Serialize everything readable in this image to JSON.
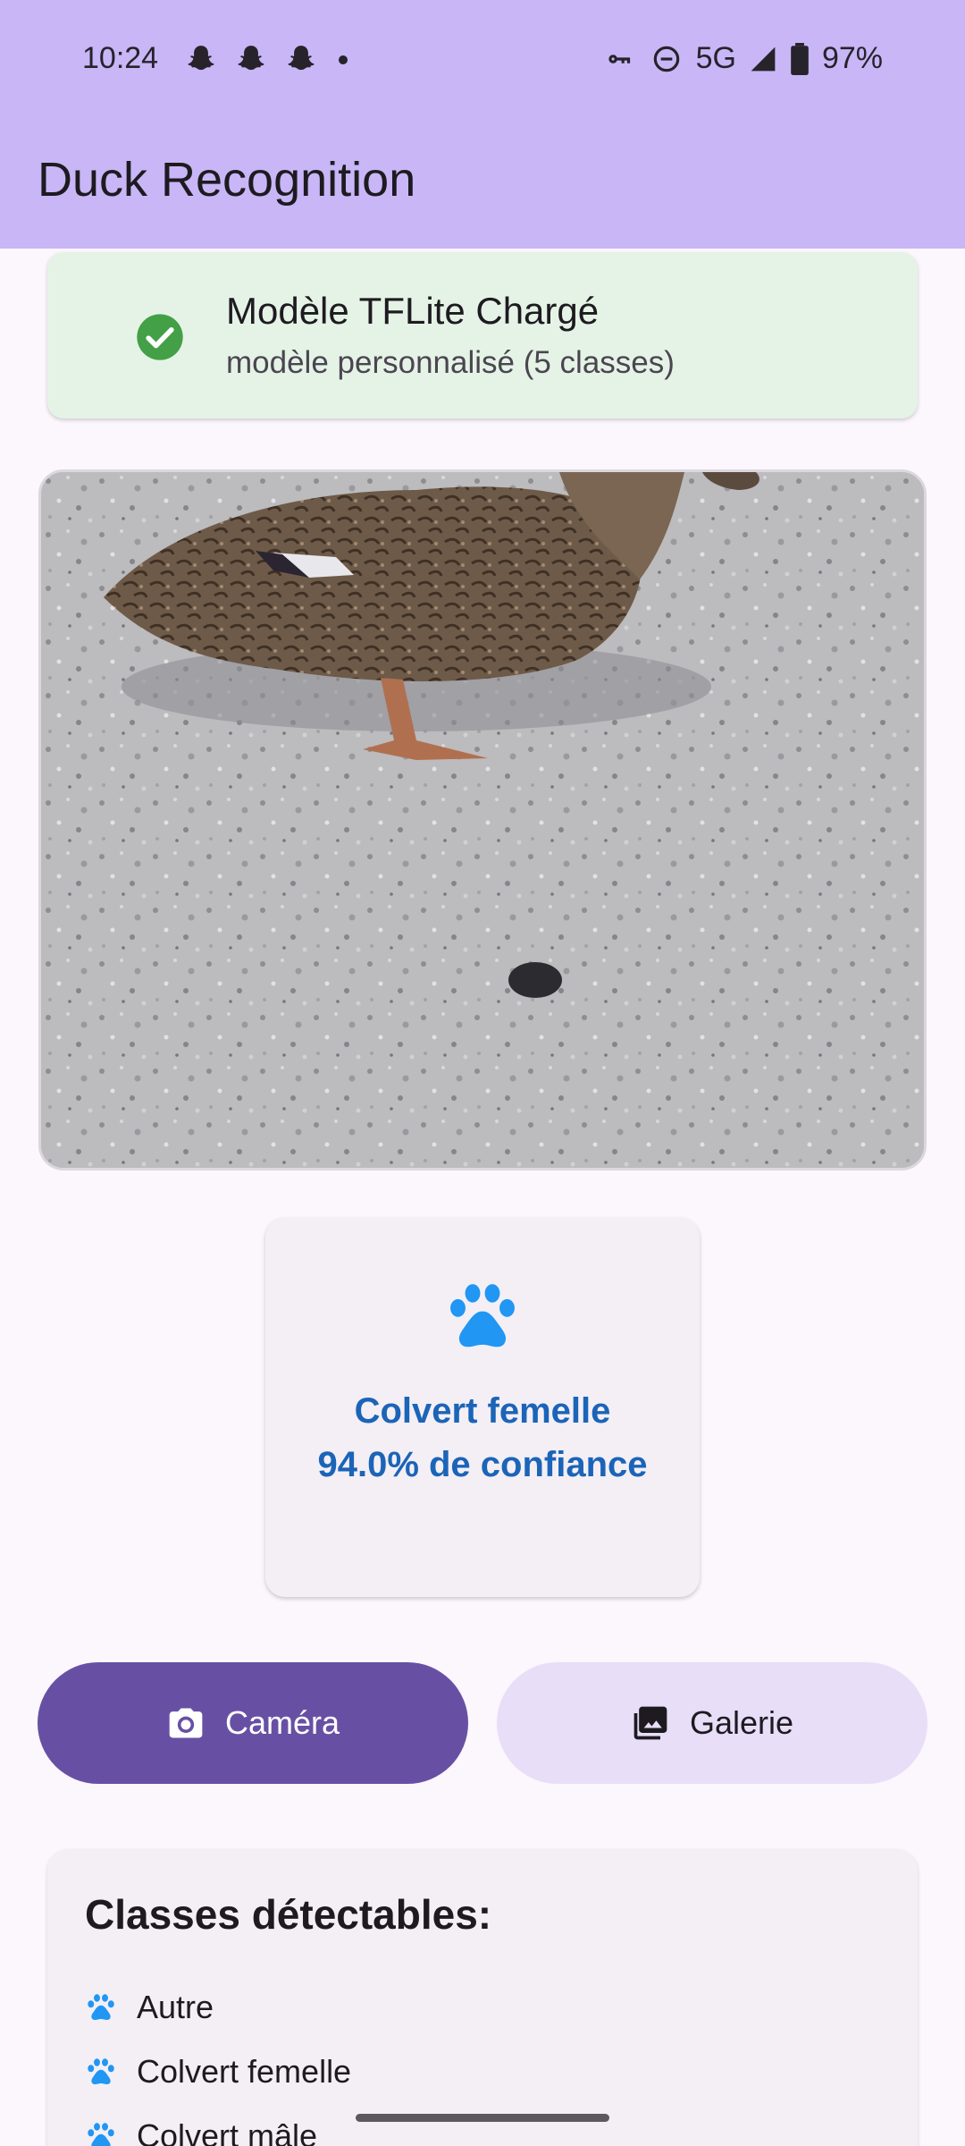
{
  "status_bar": {
    "time": "10:24",
    "notification_icons": [
      "snapchat-icon",
      "snapchat-icon",
      "snapchat-icon",
      "dot-icon"
    ],
    "network": "5G",
    "battery": "97%"
  },
  "app_bar": {
    "title": "Duck Recognition"
  },
  "model_status": {
    "title": "Modèle TFLite Chargé",
    "subtitle": "modèle personnalisé (5 classes)",
    "icon": "check-circle-icon",
    "color": "#43a047"
  },
  "photo": {
    "description_icon": "duck-photo"
  },
  "result": {
    "icon": "paw-icon",
    "label": "Colvert femelle",
    "confidence": "94.0% de confiance",
    "color": "#1b64b8"
  },
  "actions": {
    "camera_label": "Caméra",
    "camera_icon": "camera-icon",
    "gallery_label": "Galerie",
    "gallery_icon": "image-icon"
  },
  "classes": {
    "title": "Classes détectables:",
    "items": [
      {
        "label": "Autre"
      },
      {
        "label": "Colvert femelle"
      },
      {
        "label": "Colvert mâle"
      }
    ]
  },
  "colors": {
    "app_bar": "#c8b6f7",
    "primary": "#6750a4",
    "secondary_container": "#e8def8",
    "paw": "#2196f3"
  }
}
